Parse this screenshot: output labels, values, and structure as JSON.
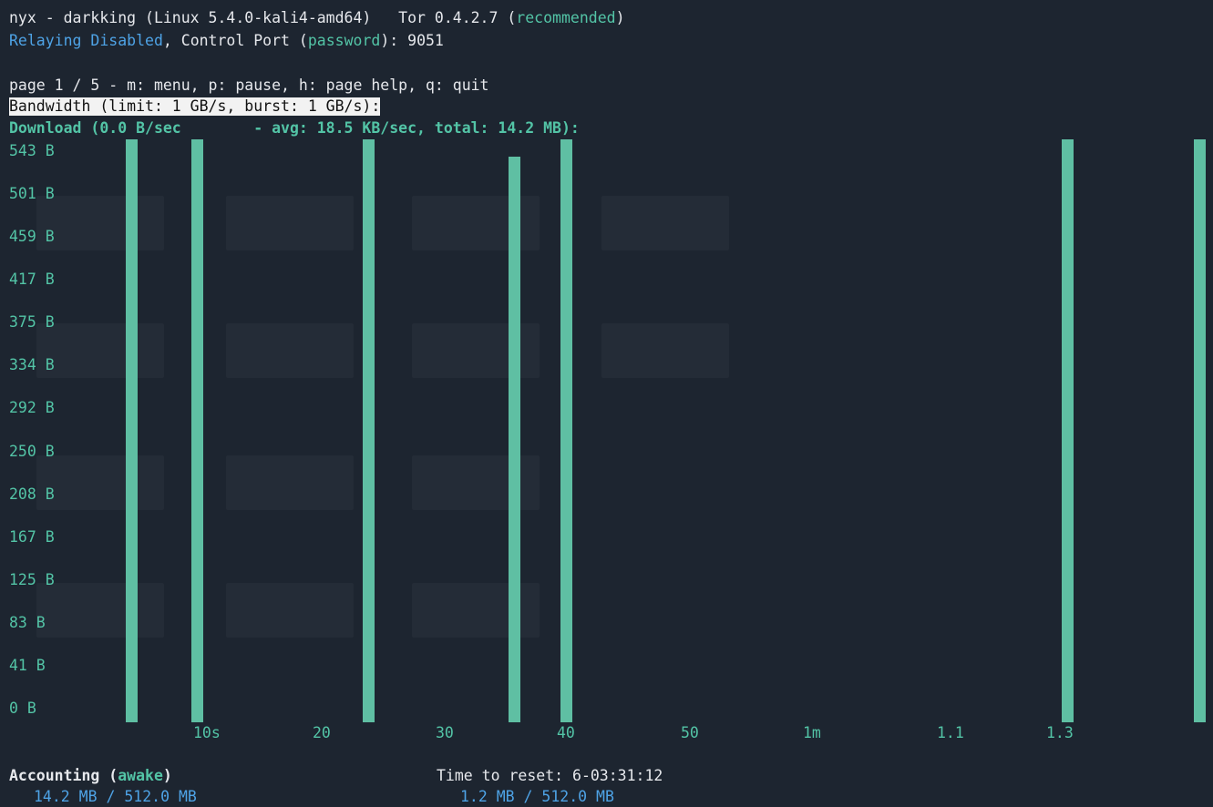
{
  "header": {
    "line1_prefix": "nyx - darkking (Linux 5.4.0-kali4-amd64)   Tor 0.4.2.7 (",
    "line1_recommended": "recommended",
    "line1_suffix": ")",
    "relaying": "Relaying Disabled",
    "control_prefix": ", Control Port (",
    "password": "password",
    "control_suffix": "): 9051"
  },
  "page_nav": "page 1 / 5 - m: menu, p: pause, h: page help, q: quit",
  "bandwidth_label": "Bandwidth (limit: 1 GB/s, burst: 1 GB/s):",
  "download_label": "Download (0.0 B/sec        - avg: 18.5 KB/sec, total: 14.2 MB):",
  "chart_data": {
    "type": "bar",
    "title": "Download (0.0 B/sec - avg: 18.5 KB/sec, total: 14.2 MB)",
    "y_ticks": [
      "543 B",
      "501 B",
      "459 B",
      "417 B",
      "375 B",
      "334 B",
      "292 B",
      "250 B",
      "208 B",
      "167 B",
      "125 B",
      "83 B",
      "41 B",
      "0 B"
    ],
    "x_ticks": [
      "10s",
      "20",
      "30",
      "40",
      "50",
      "1m",
      "1.1",
      "1.3"
    ],
    "ylim": [
      0,
      543
    ],
    "xlim": [
      0,
      85
    ],
    "x_unit": "seconds",
    "bars": [
      {
        "x": 4,
        "value": 543
      },
      {
        "x": 9,
        "value": 543
      },
      {
        "x": 22,
        "value": 543
      },
      {
        "x": 33,
        "value": 527
      },
      {
        "x": 37,
        "value": 543
      },
      {
        "x": 75,
        "value": 543
      },
      {
        "x": 85,
        "value": 543
      }
    ],
    "bar_color": "#5fbfa3"
  },
  "accounting": {
    "label": "Accounting (",
    "state": "awake",
    "label_end": ")",
    "left_usage": "14.2 MB / 512.0 MB",
    "reset_label": "Time to reset: 6-03:31:12",
    "right_usage": "1.2 MB / 512.0 MB"
  },
  "colors": {
    "background": "#1d2530",
    "accent_teal": "#53c4a6",
    "accent_blue": "#4ea3e6"
  }
}
